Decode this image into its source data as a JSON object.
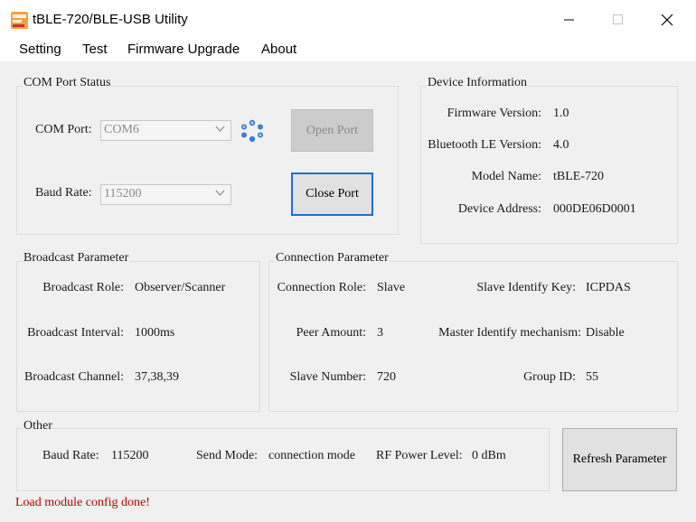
{
  "window": {
    "title": "tBLE-720/BLE-USB Utility"
  },
  "menu": [
    "Setting",
    "Test",
    "Firmware Upgrade",
    "About"
  ],
  "com_port_status": {
    "title": "COM Port  Status",
    "com_port_label": "COM Port:",
    "com_port_value": "COM6",
    "baud_rate_label": "Baud Rate:",
    "baud_rate_value": "115200",
    "open_port_label": "Open Port",
    "close_port_label": "Close Port"
  },
  "device_information": {
    "title": "Device Information",
    "rows": [
      {
        "label": "Firmware Version:",
        "value": "1.0"
      },
      {
        "label": "Bluetooth LE Version:",
        "value": "4.0"
      },
      {
        "label": "Model Name:",
        "value": "tBLE-720"
      },
      {
        "label": "Device Address:",
        "value": "000DE06D0001"
      }
    ]
  },
  "broadcast_parameter": {
    "title": "Broadcast  Parameter",
    "rows": [
      {
        "label": "Broadcast Role:",
        "value": "Observer/Scanner"
      },
      {
        "label": "Broadcast Interval:",
        "value": "1000ms"
      },
      {
        "label": "Broadcast Channel:",
        "value": "37,38,39"
      }
    ]
  },
  "connection_parameter": {
    "title": "Connection  Parameter",
    "left": [
      {
        "label": "Connection Role:",
        "value": "Slave"
      },
      {
        "label": "Peer Amount:",
        "value": "3"
      },
      {
        "label": "Slave Number:",
        "value": "720"
      }
    ],
    "right": [
      {
        "label": "Slave Identify Key:",
        "value": "ICPDAS"
      },
      {
        "label": "Master Identify mechanism:",
        "value": "Disable"
      },
      {
        "label": "Group ID:",
        "value": "55"
      }
    ]
  },
  "other": {
    "title": "Other",
    "baud_rate_label": "Baud Rate:",
    "baud_rate_value": "115200",
    "send_mode_label": "Send Mode:",
    "send_mode_value": "connection mode",
    "rf_power_label": "RF Power Level:",
    "rf_power_value": "0 dBm"
  },
  "refresh_label": "Refresh Parameter",
  "status_message": "Load module config done!",
  "colors": {
    "status": "#c00000",
    "focus_border": "#1c6fd1",
    "refresh_icon": "#3b7fd6"
  },
  "icons": [
    "app-icon",
    "minimize-icon",
    "maximize-icon",
    "close-icon",
    "refresh-ports-icon",
    "chevron-down-icon"
  ]
}
